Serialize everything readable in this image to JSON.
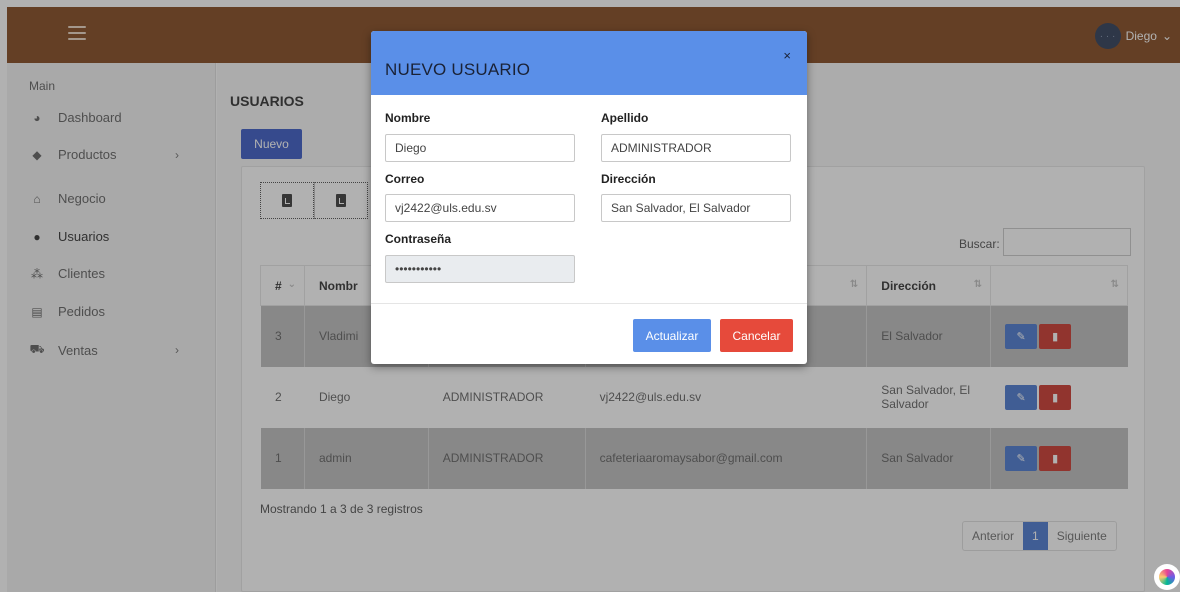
{
  "header": {
    "user_name": "Diego",
    "user_chevron": "⌄",
    "avatar_initials": "· · ·"
  },
  "sidebar": {
    "heading": "Main",
    "items": [
      {
        "label": "Dashboard",
        "icon": "pie-chart-icon",
        "glyph": "◕"
      },
      {
        "label": "Productos",
        "icon": "tags-icon",
        "glyph": "◆",
        "chevron": "›"
      },
      {
        "label": "Negocio",
        "icon": "home-icon",
        "glyph": "⌂"
      },
      {
        "label": "Usuarios",
        "icon": "user-icon",
        "glyph": "●"
      },
      {
        "label": "Clientes",
        "icon": "users-icon",
        "glyph": "⁂"
      },
      {
        "label": "Pedidos",
        "icon": "list-icon",
        "glyph": "▤"
      },
      {
        "label": "Ventas",
        "icon": "cart-icon",
        "glyph": "⛟",
        "chevron": "›"
      }
    ]
  },
  "main": {
    "title": "USUARIOS",
    "new_button": "Nuevo",
    "search_label": "Buscar:",
    "table": {
      "headers": [
        "#",
        "Nombr",
        "",
        "",
        "Dirección",
        ""
      ],
      "rows": [
        {
          "num": "3",
          "nombre": "Vladimi",
          "apellido": "",
          "correo": "",
          "direccion": "El Salvador"
        },
        {
          "num": "2",
          "nombre": "Diego",
          "apellido": "ADMINISTRADOR",
          "correo": "vj2422@uls.edu.sv",
          "direccion": "San Salvador, El Salvador"
        },
        {
          "num": "1",
          "nombre": "admin",
          "apellido": "ADMINISTRADOR",
          "correo": "cafeteriaaromaysabor@gmail.com",
          "direccion": "San Salvador"
        }
      ]
    },
    "info": "Mostrando 1 a 3 de 3 registros",
    "pager": {
      "prev": "Anterior",
      "current": "1",
      "next": "Siguiente"
    }
  },
  "modal": {
    "title": "NUEVO USUARIO",
    "close": "×",
    "fields": {
      "nombre": {
        "label": "Nombre",
        "value": "Diego"
      },
      "apellido": {
        "label": "Apellido",
        "value": "ADMINISTRADOR"
      },
      "correo": {
        "label": "Correo",
        "value": "vj2422@uls.edu.sv"
      },
      "direccion": {
        "label": "Dirección",
        "value": "San Salvador, El Salvador"
      },
      "contrasena": {
        "label": "Contraseña",
        "value": "•••••••••••"
      }
    },
    "update_button": "Actualizar",
    "cancel_button": "Cancelar"
  },
  "colors": {
    "topbar": "#7a3b0f",
    "modal_header": "#5a8fe8",
    "primary": "#2c4fc2",
    "danger": "#e64a3b"
  }
}
